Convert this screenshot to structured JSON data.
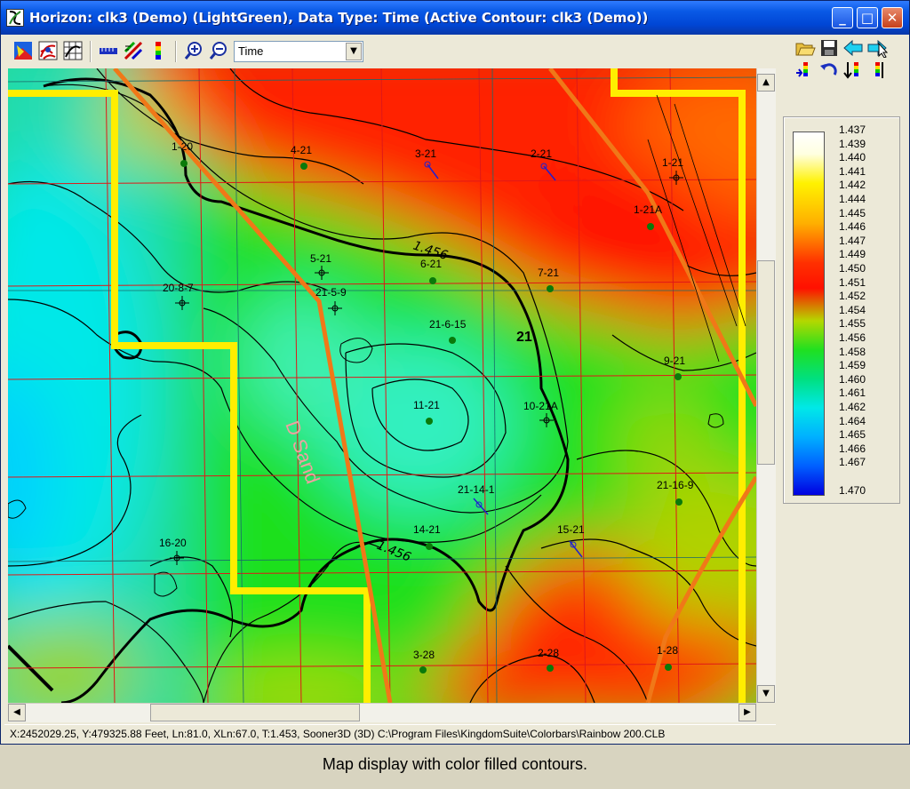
{
  "window": {
    "title": "Horizon: clk3 (Demo) (LightGreen), Data Type: Time (Active Contour: clk3 (Demo))",
    "minimize": "_",
    "maximize": "□",
    "close": "✕"
  },
  "toolbar": {
    "data_type_value": "Time",
    "icons": [
      "color-fill-icon",
      "contour-map-icon",
      "grid-display-icon",
      "ruler-icon",
      "color-scale-icon",
      "colorbar-icon",
      "zoom-in-icon",
      "zoom-out-icon"
    ]
  },
  "right_tools": {
    "icons": [
      "open-folder-icon",
      "save-icon",
      "back-arrow-icon",
      "forward-arrow-icon",
      "color-edit-icon",
      "undo-icon",
      "sort-icon",
      "colorbar-settings-icon"
    ]
  },
  "legend": {
    "labels": [
      "1.437",
      "1.439",
      "1.440",
      "1.441",
      "1.442",
      "1.444",
      "1.445",
      "1.446",
      "1.447",
      "1.449",
      "1.450",
      "1.451",
      "1.452",
      "1.454",
      "1.455",
      "1.456",
      "1.458",
      "1.459",
      "1.460",
      "1.461",
      "1.462",
      "1.464",
      "1.465",
      "1.466",
      "1.467",
      "1.470"
    ]
  },
  "map": {
    "wells": [
      "1-20",
      "4-21",
      "3-21",
      "2-21",
      "1-21",
      "1-21A",
      "5-21",
      "6-21",
      "7-21",
      "20-8-7",
      "21-5-9",
      "21-6-15",
      "9-21",
      "11-21",
      "10-21A",
      "21-14-1",
      "21-16-9",
      "14-21",
      "15-21",
      "16-20",
      "3-28",
      "2-28",
      "1-28"
    ],
    "contour_labels": [
      "1.456",
      "1.456"
    ],
    "section_label": "21",
    "formation_label": "D Sand"
  },
  "status_bar": {
    "text": "X:2452029.25,  Y:479325.88 Feet,   Ln:81.0,  XLn:67.0,   T:1.453,  Sooner3D (3D)   C:\\Program Files\\KingdomSuite\\Colorbars\\Rainbow 200.CLB"
  },
  "caption": "Map display with color filled contours."
}
